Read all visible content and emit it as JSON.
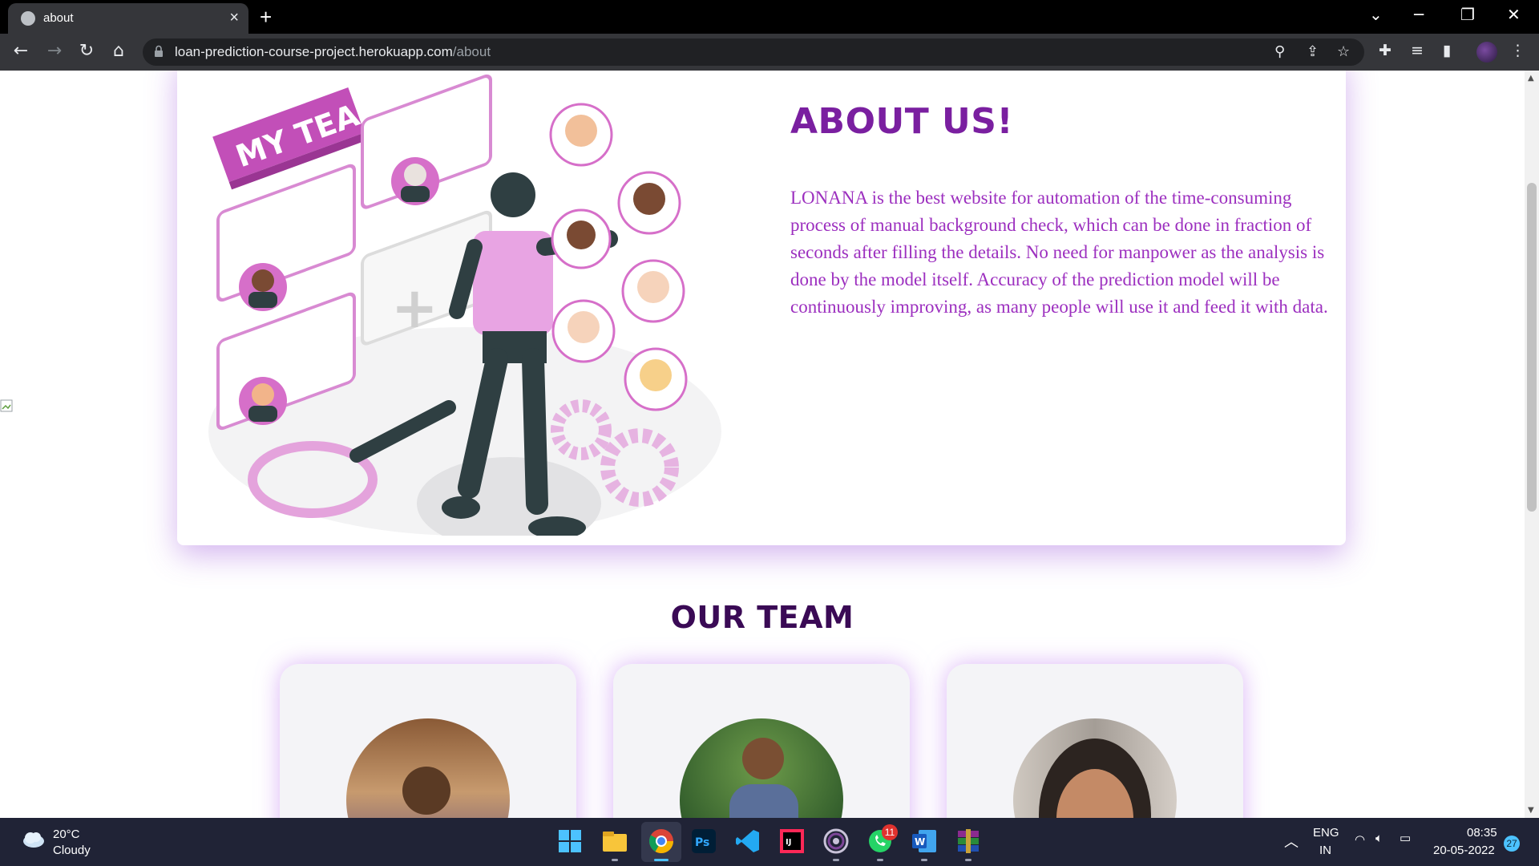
{
  "browser": {
    "tab_title": "about",
    "url_host": "loan-prediction-course-project.herokuapp.com",
    "url_path": "/about"
  },
  "about": {
    "heading": "ABOUT US!",
    "body": "LONANA is the best website for automation of the time-consuming process of manual background check, which can be done in fraction of seconds after filling the details. No need for manpower as the analysis is done by the model itself. Accuracy of the prediction model will be continuously improving, as many people will use it and feed it with data.",
    "illustration_banner": "MY TEAM"
  },
  "team": {
    "heading": "OUR TEAM"
  },
  "taskbar": {
    "temperature": "20°C",
    "weather": "Cloudy",
    "whatsapp_badge": "11",
    "lang_top": "ENG",
    "lang_bottom": "IN",
    "time": "08:35",
    "date": "20-05-2022",
    "notif_count": "27"
  },
  "colors": {
    "accent": "#7a1fa0",
    "body_text": "#9c2fbf",
    "team_heading": "#3a0a55",
    "card_glow": "#be78f0"
  }
}
